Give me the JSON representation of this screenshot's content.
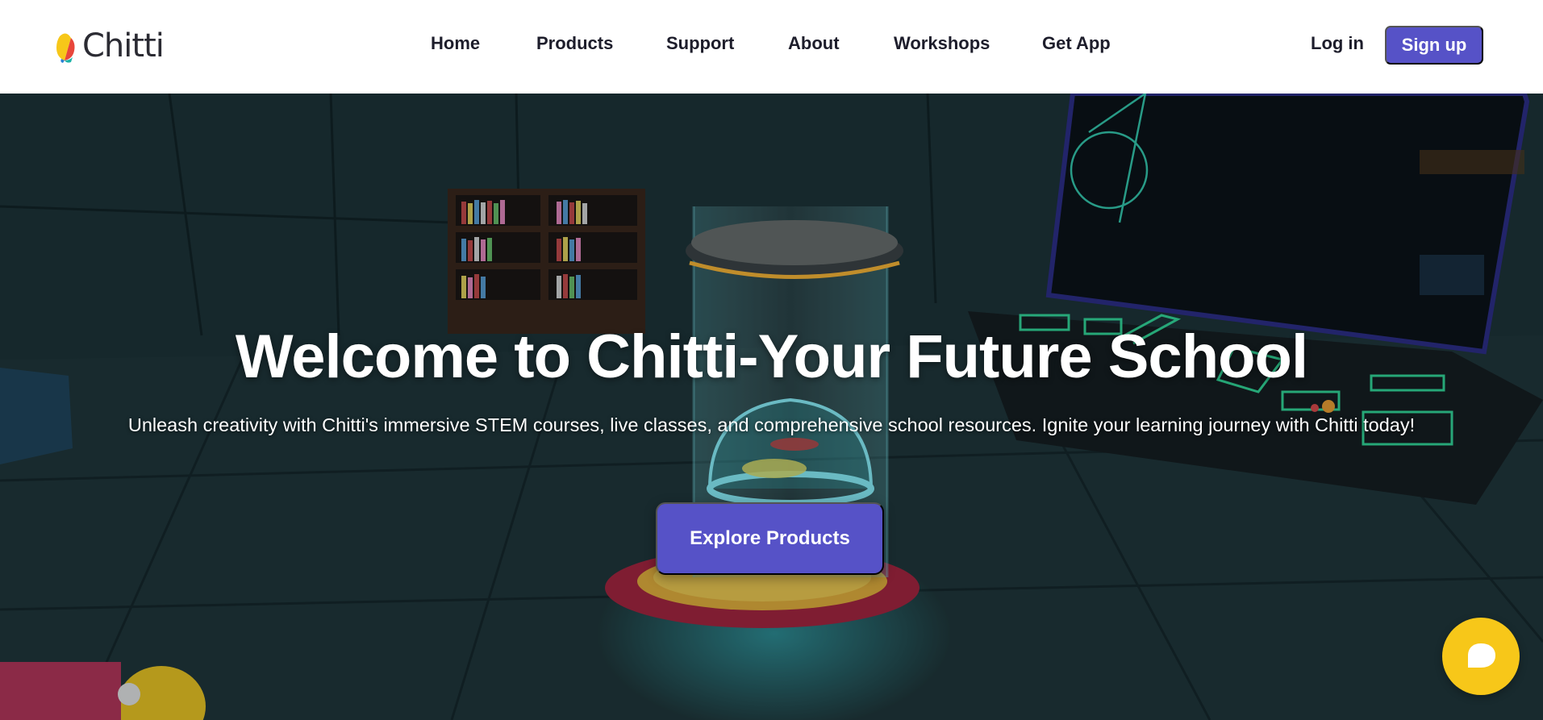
{
  "brand": {
    "name": "Chitti",
    "colors": {
      "primary": "#5652c7",
      "chat": "#f7c719",
      "logo_yellow": "#f7c719",
      "logo_red": "#e8463b",
      "logo_blue": "#2a7fd5",
      "logo_teal": "#1bb3a8"
    }
  },
  "nav": {
    "items": [
      {
        "label": "Home"
      },
      {
        "label": "Products"
      },
      {
        "label": "Support"
      },
      {
        "label": "About"
      },
      {
        "label": "Workshops"
      },
      {
        "label": "Get App"
      }
    ],
    "login_label": "Log in",
    "signup_label": "Sign up"
  },
  "hero": {
    "title": "Welcome to Chitti-Your Future School",
    "subtitle": "Unleash creativity with Chitti's immersive STEM courses, live classes, and comprehensive school resources. Ignite your learning journey with Chitti today!",
    "cta_label": "Explore Products",
    "background": "3D futuristic classroom scene with glowing holographic capsule, bookshelf and control console"
  },
  "chat": {
    "icon": "chat-bubble-icon"
  }
}
